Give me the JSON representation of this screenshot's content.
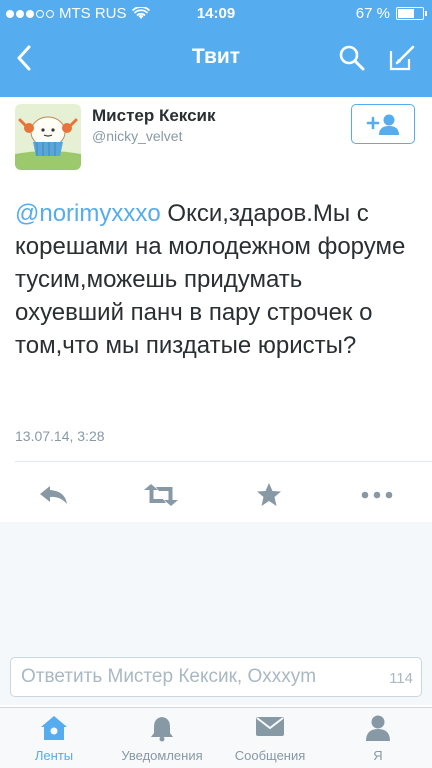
{
  "status_bar": {
    "carrier": "MTS RUS",
    "time": "14:09",
    "battery": "67 %",
    "battery_level": 0.67
  },
  "nav": {
    "title": "Твит"
  },
  "tweet": {
    "author_name": "Мистер Кексик",
    "author_handle": "@nicky_velvet",
    "mention": "@norimyxxxo",
    "text": " Окси,здаров.Мы с корешами на молодежном форуме тусим,можешь придумать охуевший панч в пару строчек о том,что мы пиздатые юристы?",
    "date": "13.07.14, 3:28"
  },
  "reply": {
    "placeholder": "Ответить Мистер Кексик, Oxxxym",
    "char_count": "114"
  },
  "tabs": [
    {
      "label": "Ленты",
      "icon": "home-icon",
      "active": true
    },
    {
      "label": "Уведомления",
      "icon": "bell-icon",
      "active": false
    },
    {
      "label": "Сообщения",
      "icon": "envelope-icon",
      "active": false
    },
    {
      "label": "Я",
      "icon": "person-icon",
      "active": false
    }
  ],
  "colors": {
    "accent": "#55acee",
    "text": "#292f33",
    "secondary": "#8899a6",
    "icon_gray": "#8899a6"
  }
}
